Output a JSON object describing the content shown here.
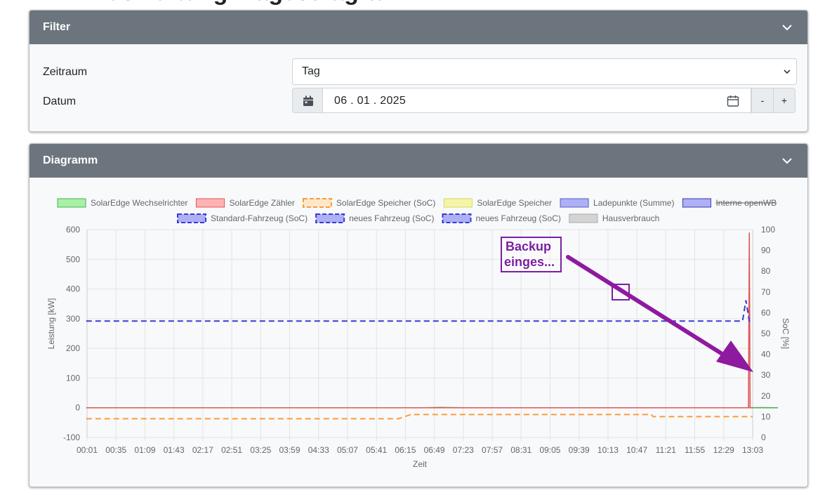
{
  "page": {
    "title": "Auswertung: Tagesdiagramm"
  },
  "filter": {
    "title": "Filter",
    "zeitraum_label": "Zeitraum",
    "zeitraum_value": "Tag",
    "datum_label": "Datum",
    "datum_value": "06 . 01 . 2025",
    "minus_label": "-",
    "plus_label": "+"
  },
  "chart_card": {
    "title": "Diagramm"
  },
  "annotation": {
    "line1": "Backup",
    "line2": "einges..."
  },
  "colors": {
    "header": "#6c757d",
    "annotation": "#8e1aa0"
  },
  "chart_data": {
    "type": "line",
    "xlabel": "Zeit",
    "ylabel": "Leistung [kW]",
    "y2label": "SoC [%]",
    "ylim": [
      -100,
      600
    ],
    "y2lim": [
      0,
      100
    ],
    "yticks": [
      "600",
      "500",
      "400",
      "300",
      "200",
      "100",
      "0",
      "-100"
    ],
    "y2ticks": [
      "100",
      "90",
      "80",
      "70",
      "60",
      "50",
      "40",
      "30",
      "20",
      "10",
      "0"
    ],
    "xticks": [
      "00:01",
      "00:35",
      "01:09",
      "01:43",
      "02:17",
      "02:51",
      "03:25",
      "03:59",
      "04:33",
      "05:07",
      "05:41",
      "06:15",
      "06:49",
      "07:23",
      "07:57",
      "08:31",
      "09:05",
      "09:39",
      "10:13",
      "10:47",
      "11:21",
      "11:55",
      "12:29",
      "13:03"
    ],
    "grid": true,
    "legend_position": "top",
    "legend": [
      {
        "label": "SolarEdge Wechselrichter",
        "fill": "#a8f0a8",
        "stroke": "#4caf50",
        "dashed": false,
        "strike": false
      },
      {
        "label": "SolarEdge Zähler",
        "fill": "#ffb3b3",
        "stroke": "#e05555",
        "dashed": false,
        "strike": false
      },
      {
        "label": "SolarEdge Speicher (SoC)",
        "fill": "#fde7c8",
        "stroke": "#fd9a3a",
        "dashed": true,
        "strike": false
      },
      {
        "label": "SolarEdge Speicher",
        "fill": "#f5f5aa",
        "stroke": "#d8d860",
        "dashed": false,
        "strike": false
      },
      {
        "label": "Ladepunkte (Summe)",
        "fill": "#aeb0f5",
        "stroke": "#5a5ad0",
        "dashed": false,
        "strike": false
      },
      {
        "label": "Interne openWB",
        "fill": "#aeb0f5",
        "stroke": "#3a3ab0",
        "dashed": false,
        "strike": true
      },
      {
        "label": "Standard-Fahrzeug (SoC)",
        "fill": "#aeb0f5",
        "stroke": "#3a3ad8",
        "dashed": true,
        "strike": false
      },
      {
        "label": "neues Fahrzeug (SoC)",
        "fill": "#aeb0f5",
        "stroke": "#3a3ad8",
        "dashed": true,
        "strike": false
      },
      {
        "label": "neues Fahrzeug (SoC)",
        "fill": "#aeb0f5",
        "stroke": "#3a3ad8",
        "dashed": true,
        "strike": false
      },
      {
        "label": "Hausverbrauch",
        "fill": "#d4d4d4",
        "stroke": "#a8a8a8",
        "dashed": false,
        "strike": false
      }
    ],
    "series": [
      {
        "name": "SolarEdge Wechselrichter",
        "axis": "left",
        "color": "#4caf50",
        "fill": "rgba(140,230,140,0.75)",
        "points": [
          [
            0,
            0
          ],
          [
            400,
            0
          ],
          [
            420,
            1
          ],
          [
            450,
            0
          ],
          [
            780,
            0
          ],
          [
            800,
            0.5
          ],
          [
            820,
            0
          ],
          [
            782,
            0
          ],
          [
            782,
            0
          ],
          [
            782,
            0
          ],
          [
            782,
            0
          ],
          [
            782,
            0
          ],
          [
            782,
            0
          ],
          [
            782,
            0
          ],
          [
            782,
            0
          ],
          [
            782,
            0
          ],
          [
            782,
            0
          ],
          [
            782,
            0
          ],
          [
            782,
            0
          ],
          [
            782,
            0
          ],
          [
            782,
            0
          ],
          [
            782,
            0
          ],
          [
            782,
            0
          ],
          [
            782,
            0
          ],
          [
            782,
            0
          ]
        ]
      },
      {
        "name": "SolarEdge Zähler",
        "axis": "left",
        "color": "#e05555",
        "fill": "rgba(255,150,150,0.5)",
        "points": [
          [
            0,
            0
          ],
          [
            785,
            0
          ],
          [
            786,
            590
          ],
          [
            787,
            0
          ],
          [
            790,
            0
          ]
        ]
      },
      {
        "name": "SolarEdge Speicher (SoC)",
        "axis": "right",
        "color": "#fd9a3a",
        "dashed": true,
        "points": [
          [
            0,
            9
          ],
          [
            370,
            9
          ],
          [
            385,
            11
          ],
          [
            670,
            11
          ],
          [
            672,
            10
          ],
          [
            790,
            10
          ]
        ]
      },
      {
        "name": "Standard-Fahrzeug (SoC)",
        "axis": "right",
        "color": "#3a3ad8",
        "dashed": true,
        "points": [
          [
            0,
            56
          ],
          [
            778,
            56
          ],
          [
            782,
            66
          ],
          [
            786,
            56
          ],
          [
            790,
            56
          ]
        ]
      }
    ],
    "x_domain_minutes": [
      1,
      790
    ]
  }
}
